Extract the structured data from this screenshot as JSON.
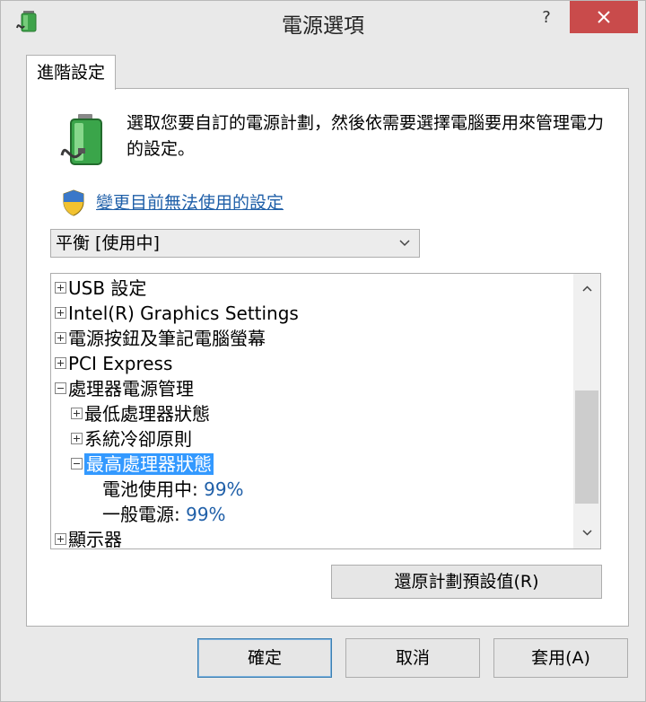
{
  "window": {
    "title": "電源選項",
    "help_label": "?"
  },
  "tab": {
    "label": "進階設定"
  },
  "description": "選取您要自訂的電源計劃，然後依需要選擇電腦要用來管理電力的設定。",
  "change_settings_link": "變更目前無法使用的設定",
  "plan_select": {
    "selected": "平衡 [使用中]"
  },
  "tree": {
    "usb": "USB 設定",
    "intel_graphics": "Intel(R) Graphics Settings",
    "power_buttons": "電源按鈕及筆記電腦螢幕",
    "pci_express": "PCI Express",
    "processor_power": "處理器電源管理",
    "min_processor_state": "最低處理器狀態",
    "cooling_policy": "系統冷卻原則",
    "max_processor_state": "最高處理器狀態",
    "on_battery_label": "電池使用中:",
    "on_battery_value": "99%",
    "plugged_in_label": "一般電源:",
    "plugged_in_value": "99%",
    "display": "顯示器"
  },
  "buttons": {
    "restore_defaults": "還原計劃預設值(R)",
    "ok": "確定",
    "cancel": "取消",
    "apply": "套用(A)"
  },
  "colors": {
    "selection": "#3399ff",
    "link": "#1f5fa8",
    "close_button": "#c94b4b"
  }
}
